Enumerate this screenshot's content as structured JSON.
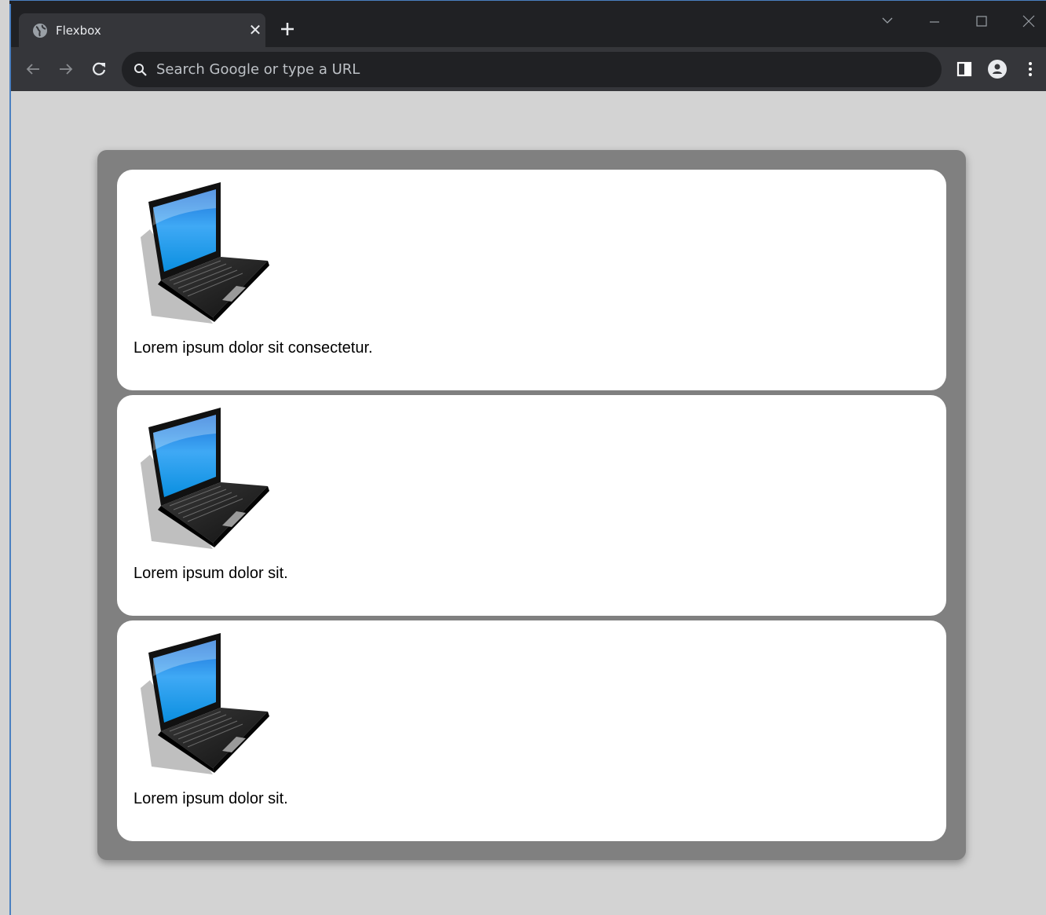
{
  "browser": {
    "tab_title": "Flexbox",
    "omnibox_placeholder": "Search Google or type a URL"
  },
  "cards": [
    {
      "text": "Lorem ipsum dolor sit consectetur.",
      "image": "laptop-image"
    },
    {
      "text": "Lorem ipsum dolor sit.",
      "image": "laptop-image"
    },
    {
      "text": "Lorem ipsum dolor sit.",
      "image": "laptop-image"
    }
  ],
  "colors": {
    "page_background": "#d3d3d3",
    "container_background": "#808080",
    "card_background": "#ffffff",
    "chrome_titlebar": "#202124",
    "chrome_toolbar": "#35363a"
  }
}
